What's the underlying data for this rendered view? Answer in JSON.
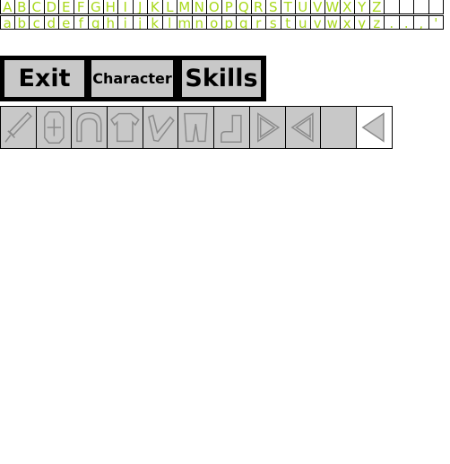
{
  "glyphs": {
    "upper": [
      "A",
      "B",
      "C",
      "D",
      "E",
      "F",
      "G",
      "H",
      "I",
      "J",
      "K",
      "L",
      "M",
      "N",
      "O",
      "P",
      "Q",
      "R",
      "S",
      "T",
      "U",
      "V",
      "W",
      "X",
      "Y",
      "Z",
      "",
      "",
      "",
      ""
    ],
    "lower": [
      "a",
      "b",
      "c",
      "d",
      "e",
      "f",
      "g",
      "h",
      "i",
      "j",
      "k",
      "l",
      "m",
      "n",
      "o",
      "p",
      "q",
      "r",
      "s",
      "t",
      "u",
      "v",
      "w",
      "x",
      "y",
      "z",
      ".",
      ".",
      ",",
      "'"
    ]
  },
  "menu": {
    "exit": "Exit",
    "character": "Character",
    "skills": "Skills"
  },
  "slots": [
    {
      "icon": "sword-icon"
    },
    {
      "icon": "shield-icon"
    },
    {
      "icon": "helmet-icon"
    },
    {
      "icon": "armor-icon"
    },
    {
      "icon": "gauntlet-icon"
    },
    {
      "icon": "leggings-icon"
    },
    {
      "icon": "boot-icon"
    },
    {
      "icon": "arrow-right-icon"
    },
    {
      "icon": "arrow-left-icon"
    },
    {
      "icon": "empty"
    },
    {
      "icon": "arrow-left-icon",
      "selected": true
    }
  ],
  "colors": {
    "glyph": "#a8d81c",
    "button_face": "#c8c8c8",
    "frame": "#000000",
    "icon_stroke": "#8c8c8c"
  }
}
